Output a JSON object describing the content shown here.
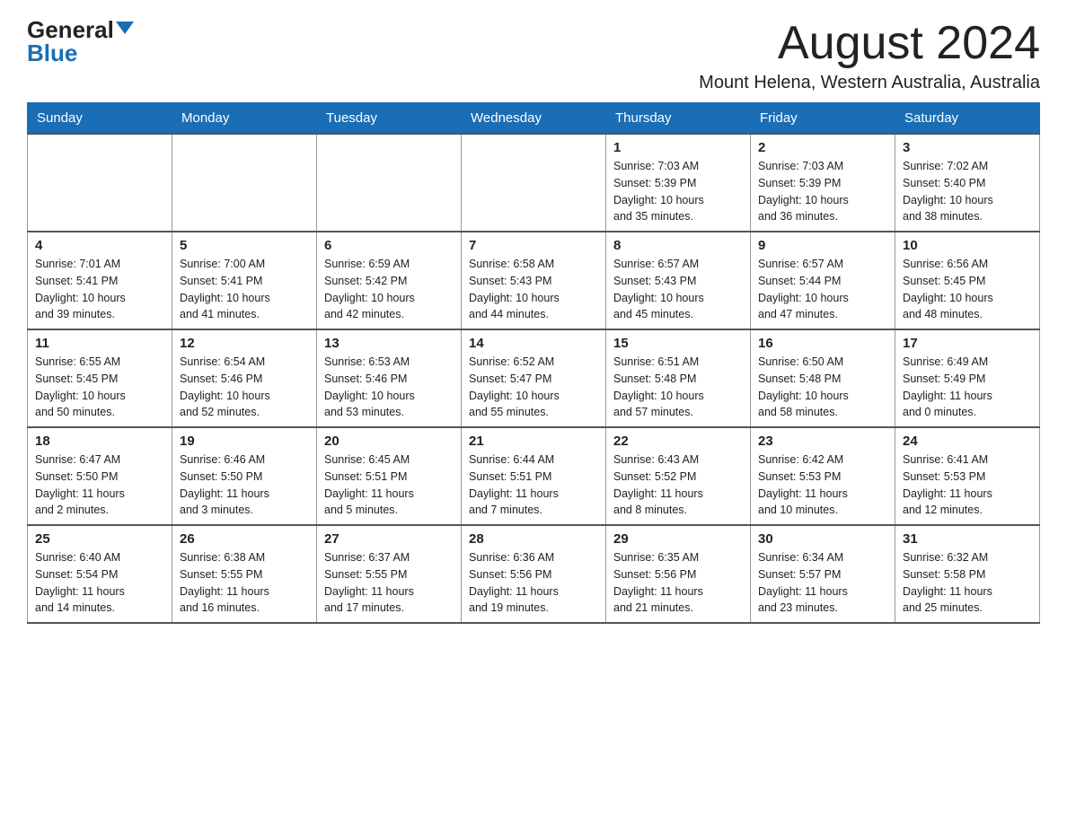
{
  "logo": {
    "general": "General",
    "blue": "Blue"
  },
  "title": "August 2024",
  "location": "Mount Helena, Western Australia, Australia",
  "days_of_week": [
    "Sunday",
    "Monday",
    "Tuesday",
    "Wednesday",
    "Thursday",
    "Friday",
    "Saturday"
  ],
  "weeks": [
    [
      {
        "day": "",
        "info": ""
      },
      {
        "day": "",
        "info": ""
      },
      {
        "day": "",
        "info": ""
      },
      {
        "day": "",
        "info": ""
      },
      {
        "day": "1",
        "info": "Sunrise: 7:03 AM\nSunset: 5:39 PM\nDaylight: 10 hours\nand 35 minutes."
      },
      {
        "day": "2",
        "info": "Sunrise: 7:03 AM\nSunset: 5:39 PM\nDaylight: 10 hours\nand 36 minutes."
      },
      {
        "day": "3",
        "info": "Sunrise: 7:02 AM\nSunset: 5:40 PM\nDaylight: 10 hours\nand 38 minutes."
      }
    ],
    [
      {
        "day": "4",
        "info": "Sunrise: 7:01 AM\nSunset: 5:41 PM\nDaylight: 10 hours\nand 39 minutes."
      },
      {
        "day": "5",
        "info": "Sunrise: 7:00 AM\nSunset: 5:41 PM\nDaylight: 10 hours\nand 41 minutes."
      },
      {
        "day": "6",
        "info": "Sunrise: 6:59 AM\nSunset: 5:42 PM\nDaylight: 10 hours\nand 42 minutes."
      },
      {
        "day": "7",
        "info": "Sunrise: 6:58 AM\nSunset: 5:43 PM\nDaylight: 10 hours\nand 44 minutes."
      },
      {
        "day": "8",
        "info": "Sunrise: 6:57 AM\nSunset: 5:43 PM\nDaylight: 10 hours\nand 45 minutes."
      },
      {
        "day": "9",
        "info": "Sunrise: 6:57 AM\nSunset: 5:44 PM\nDaylight: 10 hours\nand 47 minutes."
      },
      {
        "day": "10",
        "info": "Sunrise: 6:56 AM\nSunset: 5:45 PM\nDaylight: 10 hours\nand 48 minutes."
      }
    ],
    [
      {
        "day": "11",
        "info": "Sunrise: 6:55 AM\nSunset: 5:45 PM\nDaylight: 10 hours\nand 50 minutes."
      },
      {
        "day": "12",
        "info": "Sunrise: 6:54 AM\nSunset: 5:46 PM\nDaylight: 10 hours\nand 52 minutes."
      },
      {
        "day": "13",
        "info": "Sunrise: 6:53 AM\nSunset: 5:46 PM\nDaylight: 10 hours\nand 53 minutes."
      },
      {
        "day": "14",
        "info": "Sunrise: 6:52 AM\nSunset: 5:47 PM\nDaylight: 10 hours\nand 55 minutes."
      },
      {
        "day": "15",
        "info": "Sunrise: 6:51 AM\nSunset: 5:48 PM\nDaylight: 10 hours\nand 57 minutes."
      },
      {
        "day": "16",
        "info": "Sunrise: 6:50 AM\nSunset: 5:48 PM\nDaylight: 10 hours\nand 58 minutes."
      },
      {
        "day": "17",
        "info": "Sunrise: 6:49 AM\nSunset: 5:49 PM\nDaylight: 11 hours\nand 0 minutes."
      }
    ],
    [
      {
        "day": "18",
        "info": "Sunrise: 6:47 AM\nSunset: 5:50 PM\nDaylight: 11 hours\nand 2 minutes."
      },
      {
        "day": "19",
        "info": "Sunrise: 6:46 AM\nSunset: 5:50 PM\nDaylight: 11 hours\nand 3 minutes."
      },
      {
        "day": "20",
        "info": "Sunrise: 6:45 AM\nSunset: 5:51 PM\nDaylight: 11 hours\nand 5 minutes."
      },
      {
        "day": "21",
        "info": "Sunrise: 6:44 AM\nSunset: 5:51 PM\nDaylight: 11 hours\nand 7 minutes."
      },
      {
        "day": "22",
        "info": "Sunrise: 6:43 AM\nSunset: 5:52 PM\nDaylight: 11 hours\nand 8 minutes."
      },
      {
        "day": "23",
        "info": "Sunrise: 6:42 AM\nSunset: 5:53 PM\nDaylight: 11 hours\nand 10 minutes."
      },
      {
        "day": "24",
        "info": "Sunrise: 6:41 AM\nSunset: 5:53 PM\nDaylight: 11 hours\nand 12 minutes."
      }
    ],
    [
      {
        "day": "25",
        "info": "Sunrise: 6:40 AM\nSunset: 5:54 PM\nDaylight: 11 hours\nand 14 minutes."
      },
      {
        "day": "26",
        "info": "Sunrise: 6:38 AM\nSunset: 5:55 PM\nDaylight: 11 hours\nand 16 minutes."
      },
      {
        "day": "27",
        "info": "Sunrise: 6:37 AM\nSunset: 5:55 PM\nDaylight: 11 hours\nand 17 minutes."
      },
      {
        "day": "28",
        "info": "Sunrise: 6:36 AM\nSunset: 5:56 PM\nDaylight: 11 hours\nand 19 minutes."
      },
      {
        "day": "29",
        "info": "Sunrise: 6:35 AM\nSunset: 5:56 PM\nDaylight: 11 hours\nand 21 minutes."
      },
      {
        "day": "30",
        "info": "Sunrise: 6:34 AM\nSunset: 5:57 PM\nDaylight: 11 hours\nand 23 minutes."
      },
      {
        "day": "31",
        "info": "Sunrise: 6:32 AM\nSunset: 5:58 PM\nDaylight: 11 hours\nand 25 minutes."
      }
    ]
  ]
}
